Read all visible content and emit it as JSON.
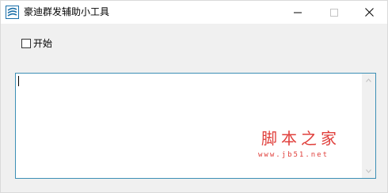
{
  "window": {
    "title": "豪迪群发辅助小工具",
    "icon": "app-logo-icon",
    "controls": {
      "minimize_icon": "minimize-icon",
      "maximize_icon": "maximize-icon",
      "close_icon": "close-icon"
    }
  },
  "start_checkbox": {
    "label": "开始",
    "checked": false
  },
  "log_textarea": {
    "value": "",
    "scrollbar_up_icon": "chevron-up-icon",
    "scrollbar_down_icon": "chevron-down-icon"
  },
  "watermark": {
    "title": "脚本之家",
    "url": "www.jb51.net"
  },
  "colors": {
    "textarea_border": "#3c8fb5",
    "watermark": "#e0403c",
    "window_bg": "#f0f0f0"
  }
}
